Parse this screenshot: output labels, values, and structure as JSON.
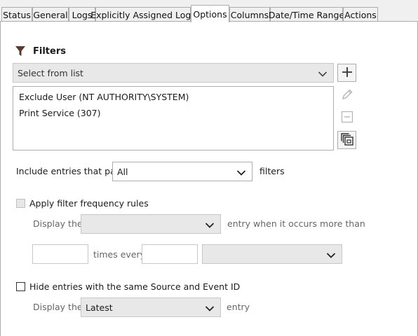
{
  "tabs": [
    {
      "label": "Status",
      "active": false
    },
    {
      "label": "General",
      "active": false
    },
    {
      "label": "Logs",
      "active": false
    },
    {
      "label": "Explicitly Assigned Logs",
      "active": false
    },
    {
      "label": "Options",
      "active": true
    },
    {
      "label": "Columns",
      "active": false
    },
    {
      "label": "Date/Time Range",
      "active": false
    },
    {
      "label": "Actions",
      "active": false
    }
  ],
  "filters": {
    "title": "Filters",
    "icon": "funnel-icon",
    "select_placeholder": "Select from list",
    "items": [
      "Exclude User (NT AUTHORITY\\SYSTEM)",
      "Print Service (307)"
    ],
    "buttons": [
      "add-icon",
      "edit-icon",
      "remove-icon",
      "copy-icon"
    ]
  },
  "include": {
    "label_before": "Include entries that pass",
    "value": "All",
    "label_after": "filters"
  },
  "frequency": {
    "checkbox_label": "Apply filter frequency rules",
    "checked": false,
    "enabled": false,
    "display_label": "Display the",
    "display_value": "",
    "entry_label": "entry when it occurs more than",
    "times_value": "",
    "times_every_label": "times every",
    "every_value": "",
    "unit_value": ""
  },
  "hide_duplicates": {
    "checkbox_label": "Hide entries with the same Source and Event ID",
    "checked": false,
    "display_label": "Display the",
    "display_value": "Latest",
    "entry_label": "entry"
  },
  "colors": {
    "panel_bg": "#ffffff",
    "chrome_bg": "#f0f0f0",
    "border": "#adadad",
    "disabled_text": "#666666"
  }
}
